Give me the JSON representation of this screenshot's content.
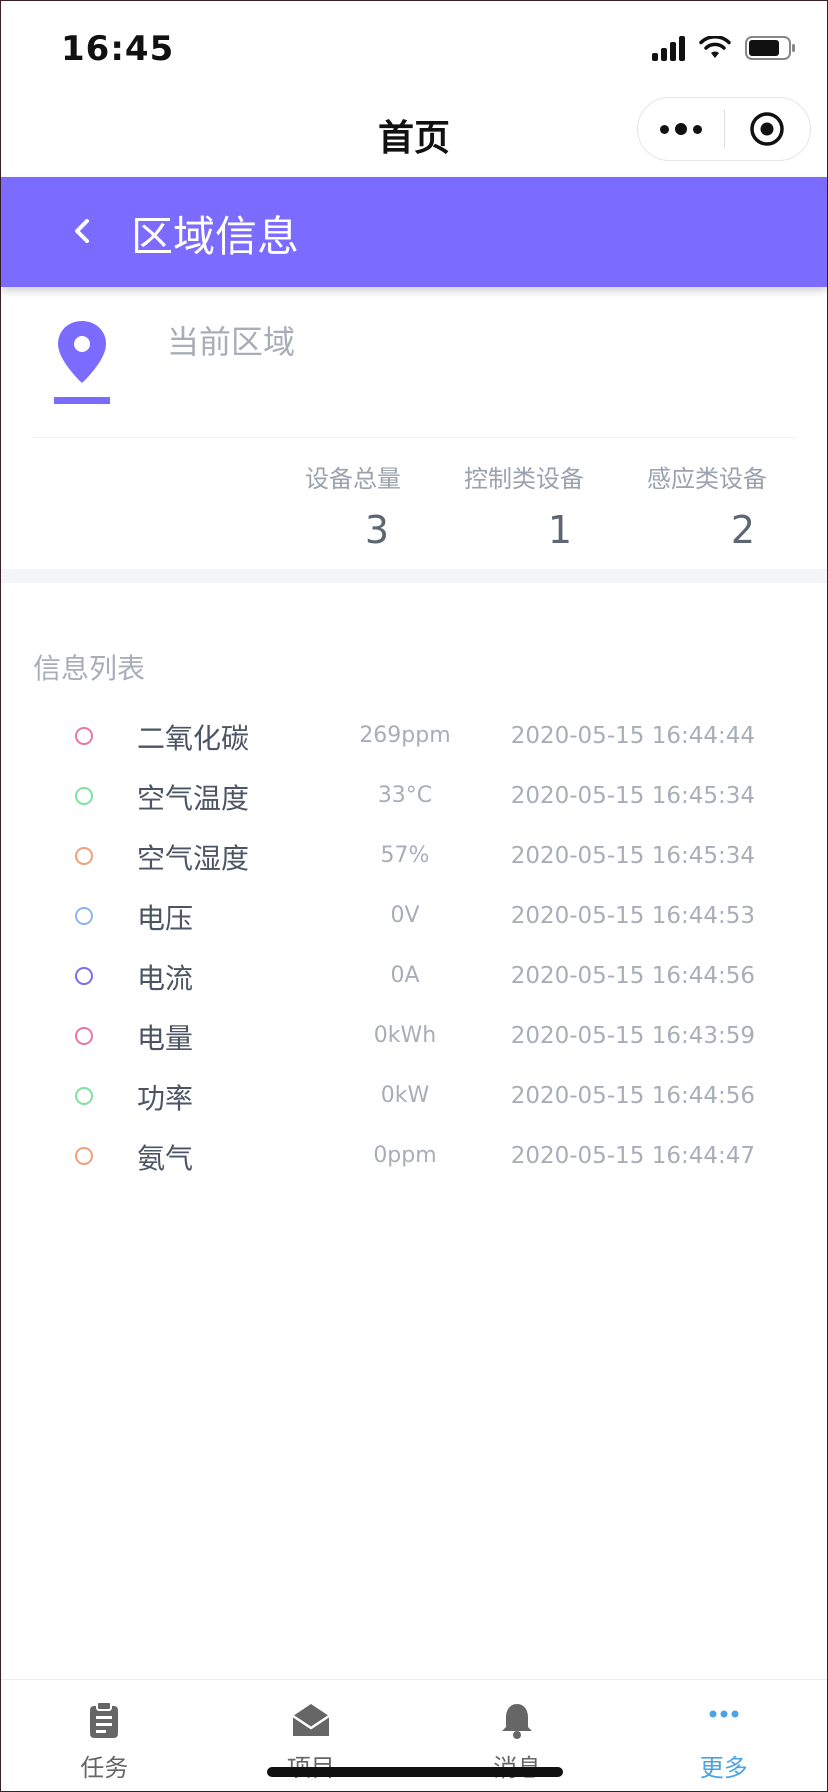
{
  "status_bar": {
    "time": "16:45"
  },
  "nav": {
    "title": "首页"
  },
  "header": {
    "title": "区域信息"
  },
  "area": {
    "label": "当前区域",
    "stats": [
      {
        "label": "设备总量",
        "value": "3"
      },
      {
        "label": "控制类设备",
        "value": "1"
      },
      {
        "label": "感应类设备",
        "value": "2"
      }
    ]
  },
  "list": {
    "title": "信息列表",
    "items": [
      {
        "name": "二氧化碳",
        "value": "269ppm",
        "time": "2020-05-15 16:44:44",
        "color": "#e8799a"
      },
      {
        "name": "空气温度",
        "value": "33°C",
        "time": "2020-05-15 16:45:34",
        "color": "#7fe0a0"
      },
      {
        "name": "空气湿度",
        "value": "57%",
        "time": "2020-05-15 16:45:34",
        "color": "#f0a07a"
      },
      {
        "name": "电压",
        "value": "0V",
        "time": "2020-05-15 16:44:53",
        "color": "#8fb4ec"
      },
      {
        "name": "电流",
        "value": "0A",
        "time": "2020-05-15 16:44:56",
        "color": "#7c6cf0"
      },
      {
        "name": "电量",
        "value": "0kWh",
        "time": "2020-05-15 16:43:59",
        "color": "#e8799a"
      },
      {
        "name": "功率",
        "value": "0kW",
        "time": "2020-05-15 16:44:56",
        "color": "#7fe0a0"
      },
      {
        "name": "氨气",
        "value": "0ppm",
        "time": "2020-05-15 16:44:47",
        "color": "#f0a07a"
      }
    ]
  },
  "tabs": [
    {
      "label": "任务",
      "icon": "clipboard-icon"
    },
    {
      "label": "项目",
      "icon": "envelope-open-icon"
    },
    {
      "label": "消息",
      "icon": "bell-icon"
    },
    {
      "label": "更多",
      "icon": "more-dots-icon",
      "active": true
    }
  ],
  "colors": {
    "accent": "#7b6cff",
    "active_tab": "#4aa3e6"
  }
}
